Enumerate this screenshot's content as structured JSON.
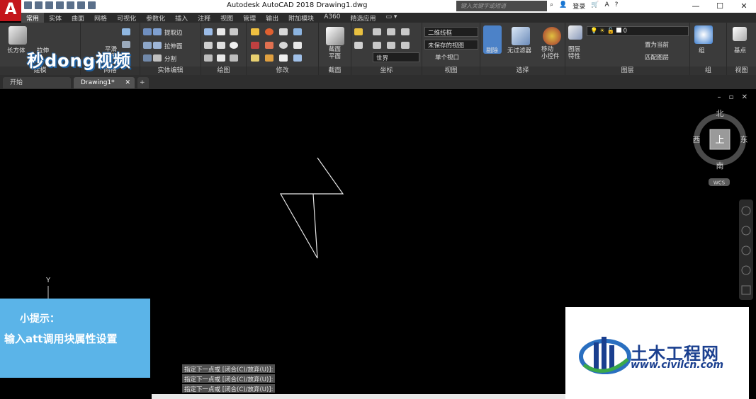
{
  "app": {
    "logo": "A",
    "title": "Autodesk AutoCAD 2018    Drawing1.dwg",
    "search_placeholder": "键入关键字或短语",
    "login_label": "登录"
  },
  "ribbon_tabs": [
    "常用",
    "实体",
    "曲面",
    "网格",
    "可视化",
    "参数化",
    "插入",
    "注释",
    "视图",
    "管理",
    "输出",
    "附加模块",
    "A360",
    "精选应用"
  ],
  "ribbon": {
    "watermark": "秒dong视频",
    "modeling": {
      "box_label": "长方体",
      "extrude_label": "拉伸",
      "title": "建模"
    },
    "mesh": {
      "smooth_label": "平滑\n对象",
      "title": "网格"
    },
    "solid_edit": {
      "extract_edges": "提取边",
      "extrude_faces": "拉伸面",
      "separate": "分割",
      "title": "实体编辑"
    },
    "draw": {
      "title": "绘图"
    },
    "modify": {
      "title": "修改"
    },
    "section": {
      "plane_label": "截面\n平面",
      "title": "截面"
    },
    "coords": {
      "world_label": "世界",
      "title": "坐标"
    },
    "view": {
      "style_value": "二维线框",
      "view_value": "未保存的视图",
      "viewport_value": "单个视口",
      "title": "视图"
    },
    "selection": {
      "cull_label": "剔除",
      "filter_label": "无过滤器",
      "gizmo_label": "移动\n小控件",
      "title": "选择"
    },
    "layers": {
      "layer_props": "图层\n特性",
      "layer_value": "0",
      "set_current": "置为当前",
      "match_layer": "匹配图层",
      "title": "图层"
    },
    "groups": {
      "group_label": "组",
      "title": "组"
    },
    "view2": {
      "base_label": "基点",
      "title": "视图"
    }
  },
  "doc_tabs": [
    {
      "label": "开始"
    },
    {
      "label": "Drawing1*"
    }
  ],
  "viewcube": {
    "north": "北",
    "south": "南",
    "east": "东",
    "west": "西",
    "face": "上",
    "wcs": "WCS"
  },
  "ucs": {
    "y_label": "Y"
  },
  "tip": {
    "title": "小提示：",
    "body": "输入att调用块属性设置"
  },
  "command_history": [
    "指定下一点或 [闭合(C)/放弃(U)]:",
    "指定下一点或 [闭合(C)/放弃(U)]:",
    "指定下一点或 [闭合(C)/放弃(U)]:"
  ],
  "brand": {
    "name": "土木工程网",
    "url": "www.civilcn.com"
  },
  "colors": {
    "titlebar": "#ffffff",
    "ribbon": "#3b3b3b",
    "canvas": "#000000",
    "tip": "#5bb4e8",
    "brand_blue": "#1a3f8f",
    "accent": "#c4161c"
  }
}
